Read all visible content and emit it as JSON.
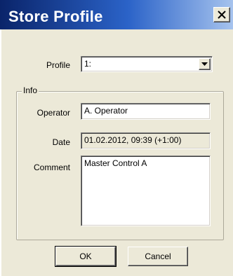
{
  "dialog": {
    "title": "Store Profile",
    "close_icon": "close-x-icon"
  },
  "profile": {
    "label": "Profile",
    "selected": "1:",
    "dropdown_icon": "chevron-down-icon"
  },
  "info": {
    "group_label": "Info",
    "operator_label": "Operator",
    "operator_value": "A. Operator",
    "date_label": "Date",
    "date_value": "01.02.2012, 09:39 (+1:00)",
    "comment_label": "Comment",
    "comment_value": "Master Control A"
  },
  "buttons": {
    "ok": "OK",
    "cancel": "Cancel"
  }
}
